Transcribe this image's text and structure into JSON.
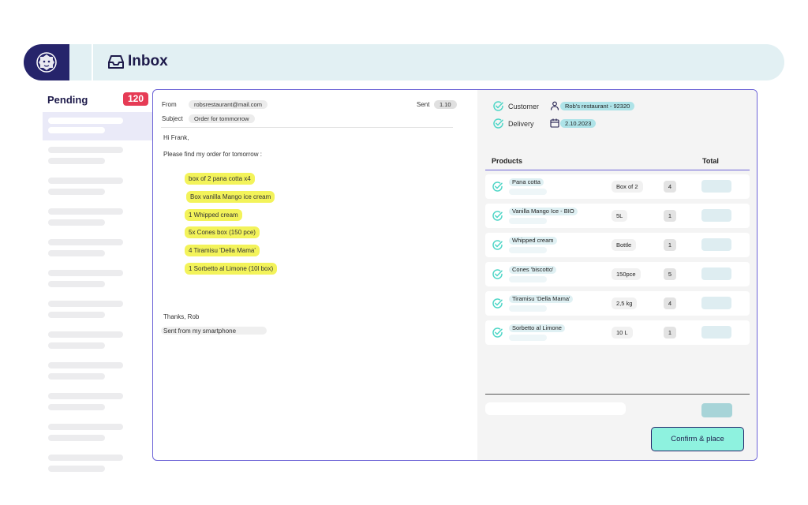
{
  "header": {
    "title": "Inbox",
    "logo_icon": "lion-logo",
    "colors": {
      "brand": "#26246b",
      "bar": "#e2f0f3"
    }
  },
  "sidebar": {
    "pending_label": "Pending",
    "pending_count": "120",
    "badge_color": "#e63b55"
  },
  "email": {
    "from_label": "From",
    "from_value": "robsrestaurant@mail.com",
    "sent_label": "Sent",
    "sent_value": "1.10",
    "subject_label": "Subject",
    "subject_value": "Order for tommorrow",
    "greeting": "Hi Frank,",
    "intro": "Please find my order for tomorrow :",
    "items": [
      "box of 2 pana cotta x4",
      "Box vanilla Mango ice cream",
      "1 Whipped cream",
      "5x Cones box (150 pce)",
      "4 Tiramisu 'Della Mama'",
      "1 Sorbetto al Limone (10l box)"
    ],
    "signoff": "Thanks, Rob",
    "footer": "Sent from my smartphone",
    "highlight_color": "#f3f35a"
  },
  "order": {
    "customer_label": "Customer",
    "customer_value": "Rob's restaurant  - 92320",
    "delivery_label": "Delivery",
    "delivery_value": "2.10.2023",
    "products_header": "Products",
    "total_header": "Total",
    "products": [
      {
        "name": "Pana cotta",
        "unit": "Box of 2",
        "qty": "4"
      },
      {
        "name": "Vanilla Mango  Ice - BIO",
        "unit": "5L",
        "qty": "1"
      },
      {
        "name": "Whipped cream",
        "unit": "Bottle",
        "qty": "1"
      },
      {
        "name": "Cones  'biscotto'",
        "unit": "150pce",
        "qty": "5"
      },
      {
        "name": "Tiramisu 'Della Mama'",
        "unit": "2,5 kg",
        "qty": "4"
      },
      {
        "name": "Sorbetto al Limone",
        "unit": "10 L",
        "qty": "1"
      }
    ],
    "confirm_label": "Confirm & place",
    "confirm_color": "#8ef2df"
  }
}
